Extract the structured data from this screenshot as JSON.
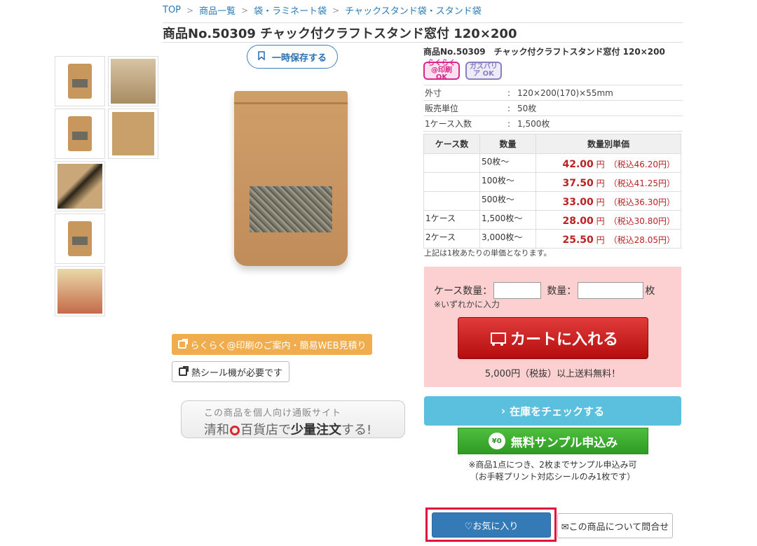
{
  "breadcrumb": [
    "TOP",
    "商品一覧",
    "袋・ラミネート袋",
    "チャックスタンド袋・スタンド袋"
  ],
  "page_title": "商品No.50309 チャック付クラフトスタンド窓付 120×200",
  "save_button": "一時保存する",
  "product_name": "商品No.50309　チャック付クラフトスタンド窓付 120×200",
  "badges": {
    "print": "らくらく@印刷 OK",
    "barrier": "ガスバリア OK"
  },
  "specs": [
    {
      "key": "外寸",
      "value": "120×200(170)×55mm"
    },
    {
      "key": "販売単位",
      "value": "50枚"
    },
    {
      "key": "1ケース入数",
      "value": "1,500枚"
    }
  ],
  "price_table": {
    "headers": [
      "ケース数",
      "数量",
      "数量別単価"
    ],
    "rows": [
      {
        "case": "",
        "qty": "50枚～",
        "price": "42.00",
        "unit": "円",
        "tax": "（税込46.20円）"
      },
      {
        "case": "",
        "qty": "100枚～",
        "price": "37.50",
        "unit": "円",
        "tax": "（税込41.25円）"
      },
      {
        "case": "",
        "qty": "500枚～",
        "price": "33.00",
        "unit": "円",
        "tax": "（税込36.30円）"
      },
      {
        "case": "1ケース",
        "qty": "1,500枚～",
        "price": "28.00",
        "unit": "円",
        "tax": "（税込30.80円）"
      },
      {
        "case": "2ケース",
        "qty": "3,000枚～",
        "price": "25.50",
        "unit": "円",
        "tax": "（税込28.05円）"
      }
    ],
    "note": "上記は1枚あたりの単価となります。"
  },
  "order": {
    "case_label": "ケース数量：",
    "qty_label": "数量：",
    "qty_unit": "枚",
    "note": "※いずれかに入力",
    "cart_button": "カートに入れる",
    "shipping": "5,000円（税抜）以上送料無料！"
  },
  "buttons": {
    "print_guide": "らくらく@印刷のご案内・簡易WEB見積り",
    "heat_seal": "熱シール機が必要です",
    "stock_check": "在庫をチェックする",
    "sample": "無料サンプル申込み",
    "favorite": "♡お気に入り",
    "inquiry": "✉この商品について問合せ"
  },
  "sample_note": [
    "※商品1点につき、2枚までサンプル申込み可",
    "（お手軽プリント対応シールのみ1枚です）"
  ],
  "promo": {
    "line1": "この商品を個人向け通販サイト",
    "line2_a": "清和",
    "line2_b": "百貨店で",
    "line2_bold": "少量注文",
    "line2_c": "する!"
  },
  "colors": {
    "link": "#2a7ab8",
    "price": "#bb2222",
    "cart": "#c41a1a",
    "stock": "#5bc0de",
    "sample": "#3aa82d",
    "favorite": "#337ab7",
    "order_bg": "#fcd0d0"
  }
}
